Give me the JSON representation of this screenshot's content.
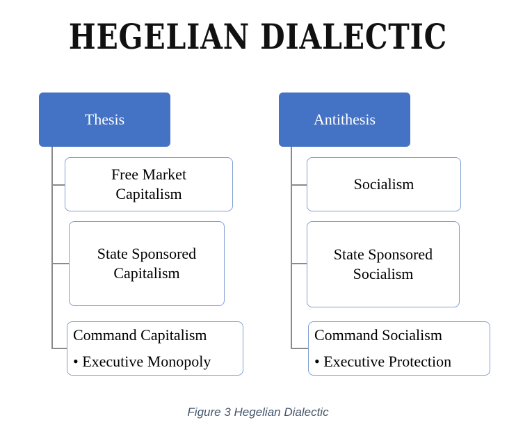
{
  "title": "HEGELIAN DIALECTIC",
  "caption": "Figure 3 Hegelian Dialectic",
  "colors": {
    "header_fill": "#4472c4",
    "child_border": "#7f9fd3",
    "connector": "#8a8a8a",
    "caption": "#44546a"
  },
  "thesis": {
    "label": "Thesis",
    "items": [
      {
        "line1": "Free Market",
        "line2": "Capitalism"
      },
      {
        "line1": "State Sponsored",
        "line2": "Capitalism"
      },
      {
        "line1": "Command  Capitalism",
        "line2": "• Executive Monopoly"
      }
    ]
  },
  "antithesis": {
    "label": "Antithesis",
    "items": [
      {
        "line1": "Socialism"
      },
      {
        "line1": "State Sponsored",
        "line2": "Socialism"
      },
      {
        "line1": "Command  Socialism",
        "line2": "• Executive Protection"
      }
    ]
  }
}
